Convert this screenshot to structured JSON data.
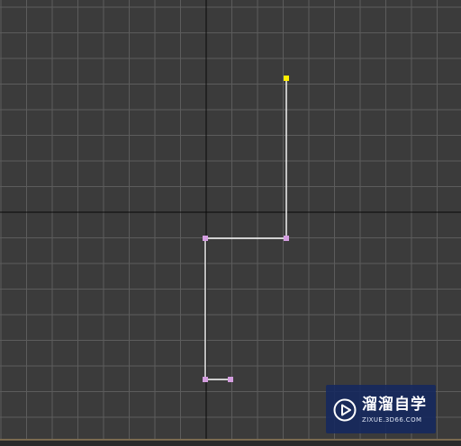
{
  "viewport": {
    "background_color": "#3b3b3b",
    "grid_color": "#5c5c5c",
    "axis_color": "#0a0a0a",
    "shape_color": "#ffffff",
    "vertex_color": "#d49ee0",
    "first_vertex_color": "#ffee00"
  },
  "watermark": {
    "title": "溜溜自学",
    "url": "ZIXUE.3D66.COM",
    "icon": "play-circle-icon"
  }
}
